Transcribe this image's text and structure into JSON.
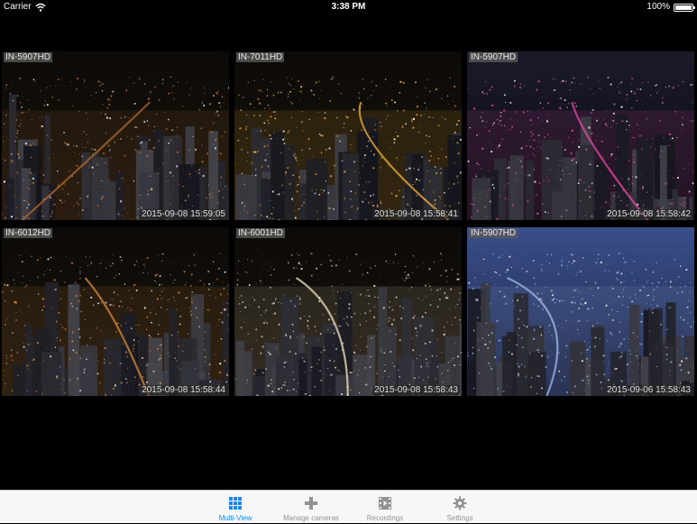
{
  "status_bar": {
    "carrier": "Carrier",
    "time": "3:38 PM",
    "battery": "100%",
    "battery_level": 1.0
  },
  "cameras": [
    {
      "name": "IN-5907HD",
      "timestamp": "2015-09-08 15:59:05",
      "theme": "#b06a30"
    },
    {
      "name": "IN-7011HD",
      "timestamp": "2015-09-08 15:58:41",
      "theme": "#f2b13a"
    },
    {
      "name": "IN-5907HD",
      "timestamp": "2015-09-08 15:58:42",
      "theme": "#e84aa6"
    },
    {
      "name": "IN-6012HD",
      "timestamp": "2015-09-08 15:58:44",
      "theme": "#d88a3a"
    },
    {
      "name": "IN-6001HD",
      "timestamp": "2015-09-08 15:58:43",
      "theme": "#f0e2c0"
    },
    {
      "name": "IN-5907HD",
      "timestamp": "2015-09-06 15:58:43",
      "theme": "#9fb8e8"
    }
  ],
  "tabs": [
    {
      "label": "Multi-View",
      "icon": "grid-icon",
      "active": true
    },
    {
      "label": "Manage cameras",
      "icon": "plus-icon",
      "active": false
    },
    {
      "label": "Recordings",
      "icon": "film-icon",
      "active": false
    },
    {
      "label": "Settings",
      "icon": "gear-icon",
      "active": false
    }
  ],
  "colors": {
    "accent": "#1a86f5",
    "tab_inactive": "#929292",
    "tab_bar_bg": "#f7f7f8"
  }
}
